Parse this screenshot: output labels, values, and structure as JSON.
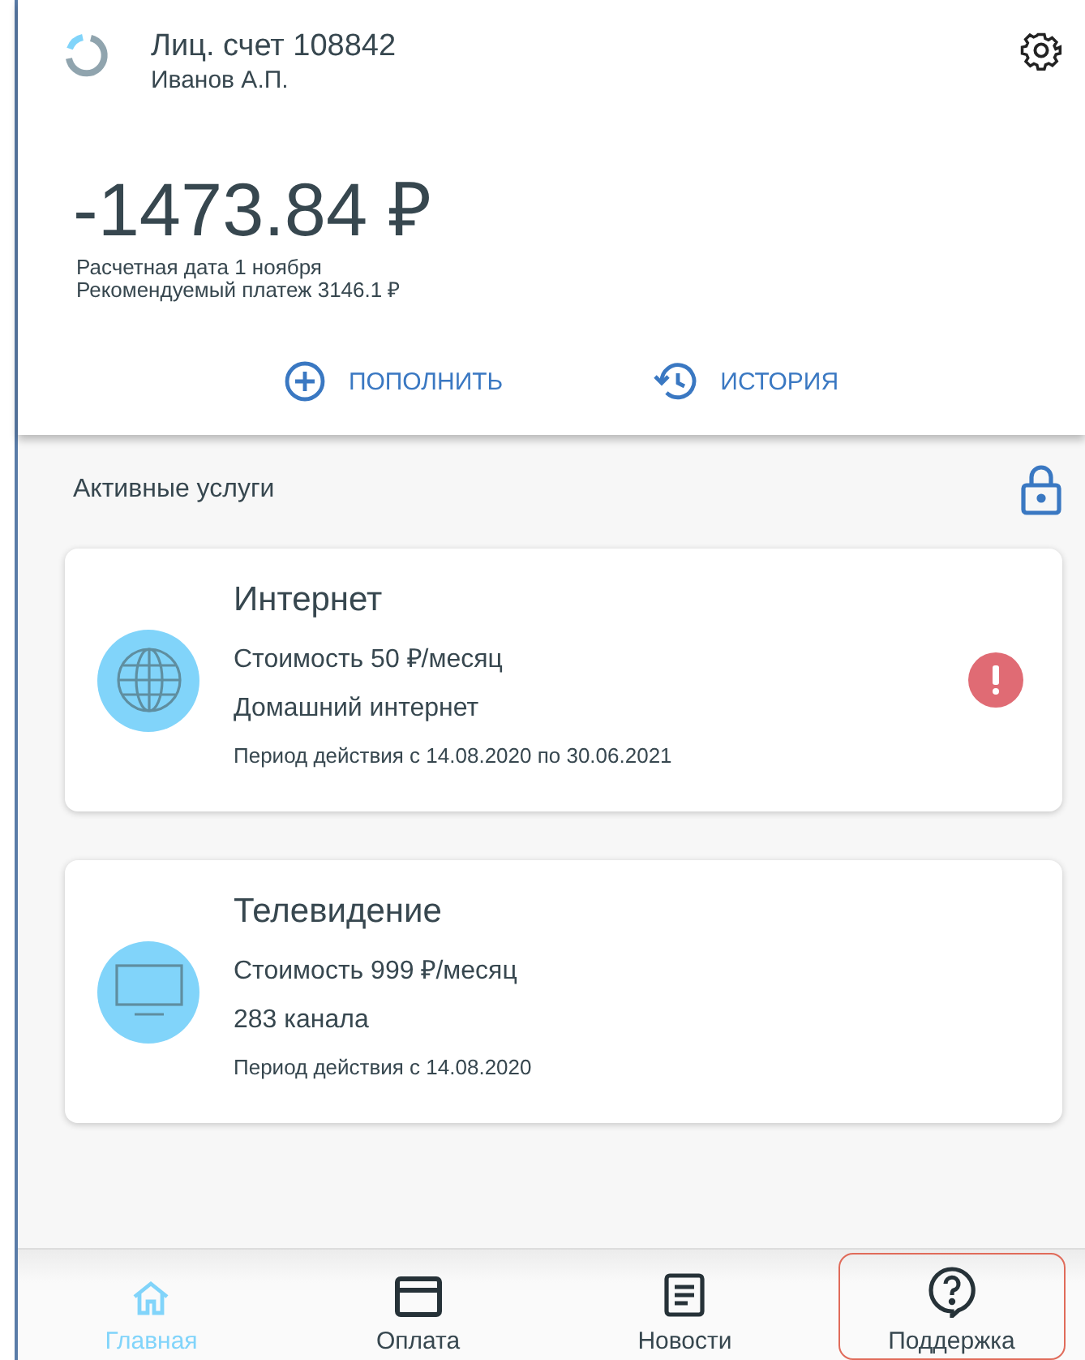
{
  "account": {
    "number": "Лиц. счет 108842",
    "owner": "Иванов А.П."
  },
  "balance": {
    "amount": "-1473.84 ₽",
    "billing_date": "Расчетная дата 1 ноября",
    "recommended": "Рекомендуемый платеж 3146.1 ₽"
  },
  "actions": [
    {
      "kind": "topup",
      "label": "ПОПОЛНИТЬ"
    },
    {
      "kind": "history",
      "label": "ИСТОРИЯ"
    }
  ],
  "services": {
    "title": "Активные услуги",
    "items": [
      {
        "kind": "internet",
        "name": "Интернет",
        "price": "Стоимость 50 ₽/месяц",
        "detail": "Домашний интернет",
        "period": "Период действия с 14.08.2020 по 30.06.2021",
        "alert": true
      },
      {
        "kind": "tv",
        "name": "Телевидение",
        "price": "Стоимость 999 ₽/месяц",
        "detail": "283 канала",
        "period": "Период действия с 14.08.2020",
        "alert": false
      }
    ]
  },
  "nav": [
    {
      "kind": "home",
      "label": "Главная",
      "selected": true,
      "focused": false
    },
    {
      "kind": "payment",
      "label": "Оплата",
      "selected": false,
      "focused": false
    },
    {
      "kind": "news",
      "label": "Новости",
      "selected": false,
      "focused": false
    },
    {
      "kind": "support",
      "label": "Поддержка",
      "selected": false,
      "focused": true
    }
  ]
}
